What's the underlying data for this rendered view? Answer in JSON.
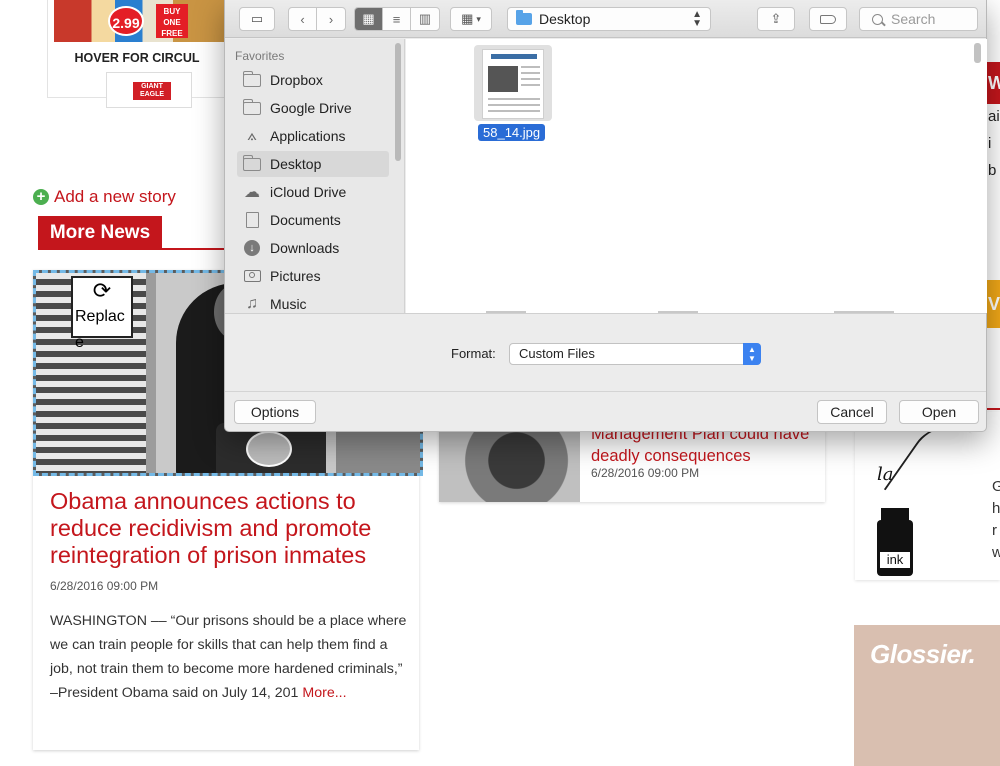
{
  "ad": {
    "price": "2.99",
    "bogo": "BUY ONE FREE",
    "hover_text": "HOVER FOR CIRCUL",
    "logo_text": "GIANT EAGLE"
  },
  "add_story": "Add a new story",
  "section_tab": "More News",
  "main_story": {
    "replace_label": "Replace",
    "headline": "Obama announces actions to reduce recidivism and promote reintegration of prison inmates",
    "date": "6/28/2016 09:00 PM",
    "excerpt": "WASHINGTON –– “Our prisons should be a place where we can train people for skills that can help them find a job, not train them to become more hardened criminals,” –President Obama said on July 14, 201",
    "more_link": "More..."
  },
  "mid_story": {
    "headline": "Management Plan could have deadly consequences",
    "date": "6/28/2016 09:00 PM"
  },
  "right_story": {
    "la_text": "la",
    "ink_label": "ink",
    "letters": [
      "G",
      "h",
      "r",
      "w"
    ]
  },
  "glossier_ad": {
    "text": "Glossier."
  },
  "right_edge": {
    "red_text": "W",
    "lines": [
      "ai",
      "i",
      "b"
    ],
    "yellow_text": "V"
  },
  "dialog": {
    "location": "Desktop",
    "search_placeholder": "Search",
    "sidebar": {
      "heading": "Favorites",
      "items": [
        {
          "label": "Dropbox",
          "icon": "folder-icon",
          "selected": false
        },
        {
          "label": "Google Drive",
          "icon": "folder-icon",
          "selected": false
        },
        {
          "label": "Applications",
          "icon": "applications-icon",
          "selected": false
        },
        {
          "label": "Desktop",
          "icon": "folder-icon",
          "selected": true
        },
        {
          "label": "iCloud Drive",
          "icon": "cloud-icon",
          "selected": false
        },
        {
          "label": "Documents",
          "icon": "document-icon",
          "selected": false
        },
        {
          "label": "Downloads",
          "icon": "download-icon",
          "selected": false
        },
        {
          "label": "Pictures",
          "icon": "camera-icon",
          "selected": false
        },
        {
          "label": "Music",
          "icon": "music-note-icon",
          "selected": false
        }
      ]
    },
    "file": {
      "name": "58_14.jpg"
    },
    "format_label": "Format:",
    "format_value": "Custom Files",
    "options_label": "Options",
    "cancel_label": "Cancel",
    "open_label": "Open"
  }
}
